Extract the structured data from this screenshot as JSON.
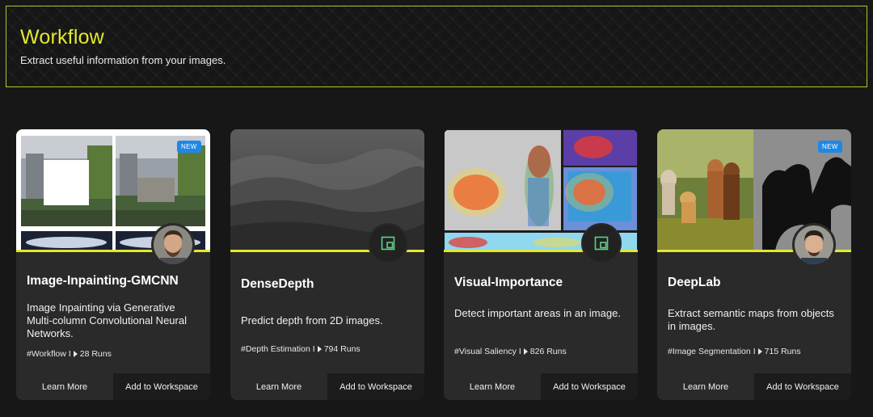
{
  "banner": {
    "title": "Workflow",
    "subtitle": "Extract useful information from your images."
  },
  "cards": [
    {
      "title": "Image-Inpainting-GMCNN",
      "description": "Image Inpainting via Generative Multi-column Convolutional Neural Networks.",
      "tag": "#Workflow",
      "runs": "28 Runs",
      "badge": "NEW",
      "learn_label": "Learn More",
      "add_label": "Add to Workspace"
    },
    {
      "title": "DenseDepth",
      "description": "Predict depth from 2D images.",
      "tag": "#Depth Estimation",
      "runs": "794 Runs",
      "learn_label": "Learn More",
      "add_label": "Add to Workspace"
    },
    {
      "title": "Visual-Importance",
      "description": "Detect important areas in an image.",
      "tag": "#Visual Saliency",
      "runs": "826 Runs",
      "learn_label": "Learn More",
      "add_label": "Add to Workspace"
    },
    {
      "title": "DeepLab",
      "description": "Extract semantic maps from objects in images.",
      "tag": "#Image Segmentation",
      "runs": "715 Runs",
      "badge": "NEW",
      "learn_label": "Learn More",
      "add_label": "Add to Workspace"
    }
  ],
  "separator": "I",
  "colors": {
    "accent_yellow": "#e3e82f",
    "badge_blue": "#1e88e5",
    "card_bg": "#2a2a2a",
    "page_bg": "#171717"
  }
}
